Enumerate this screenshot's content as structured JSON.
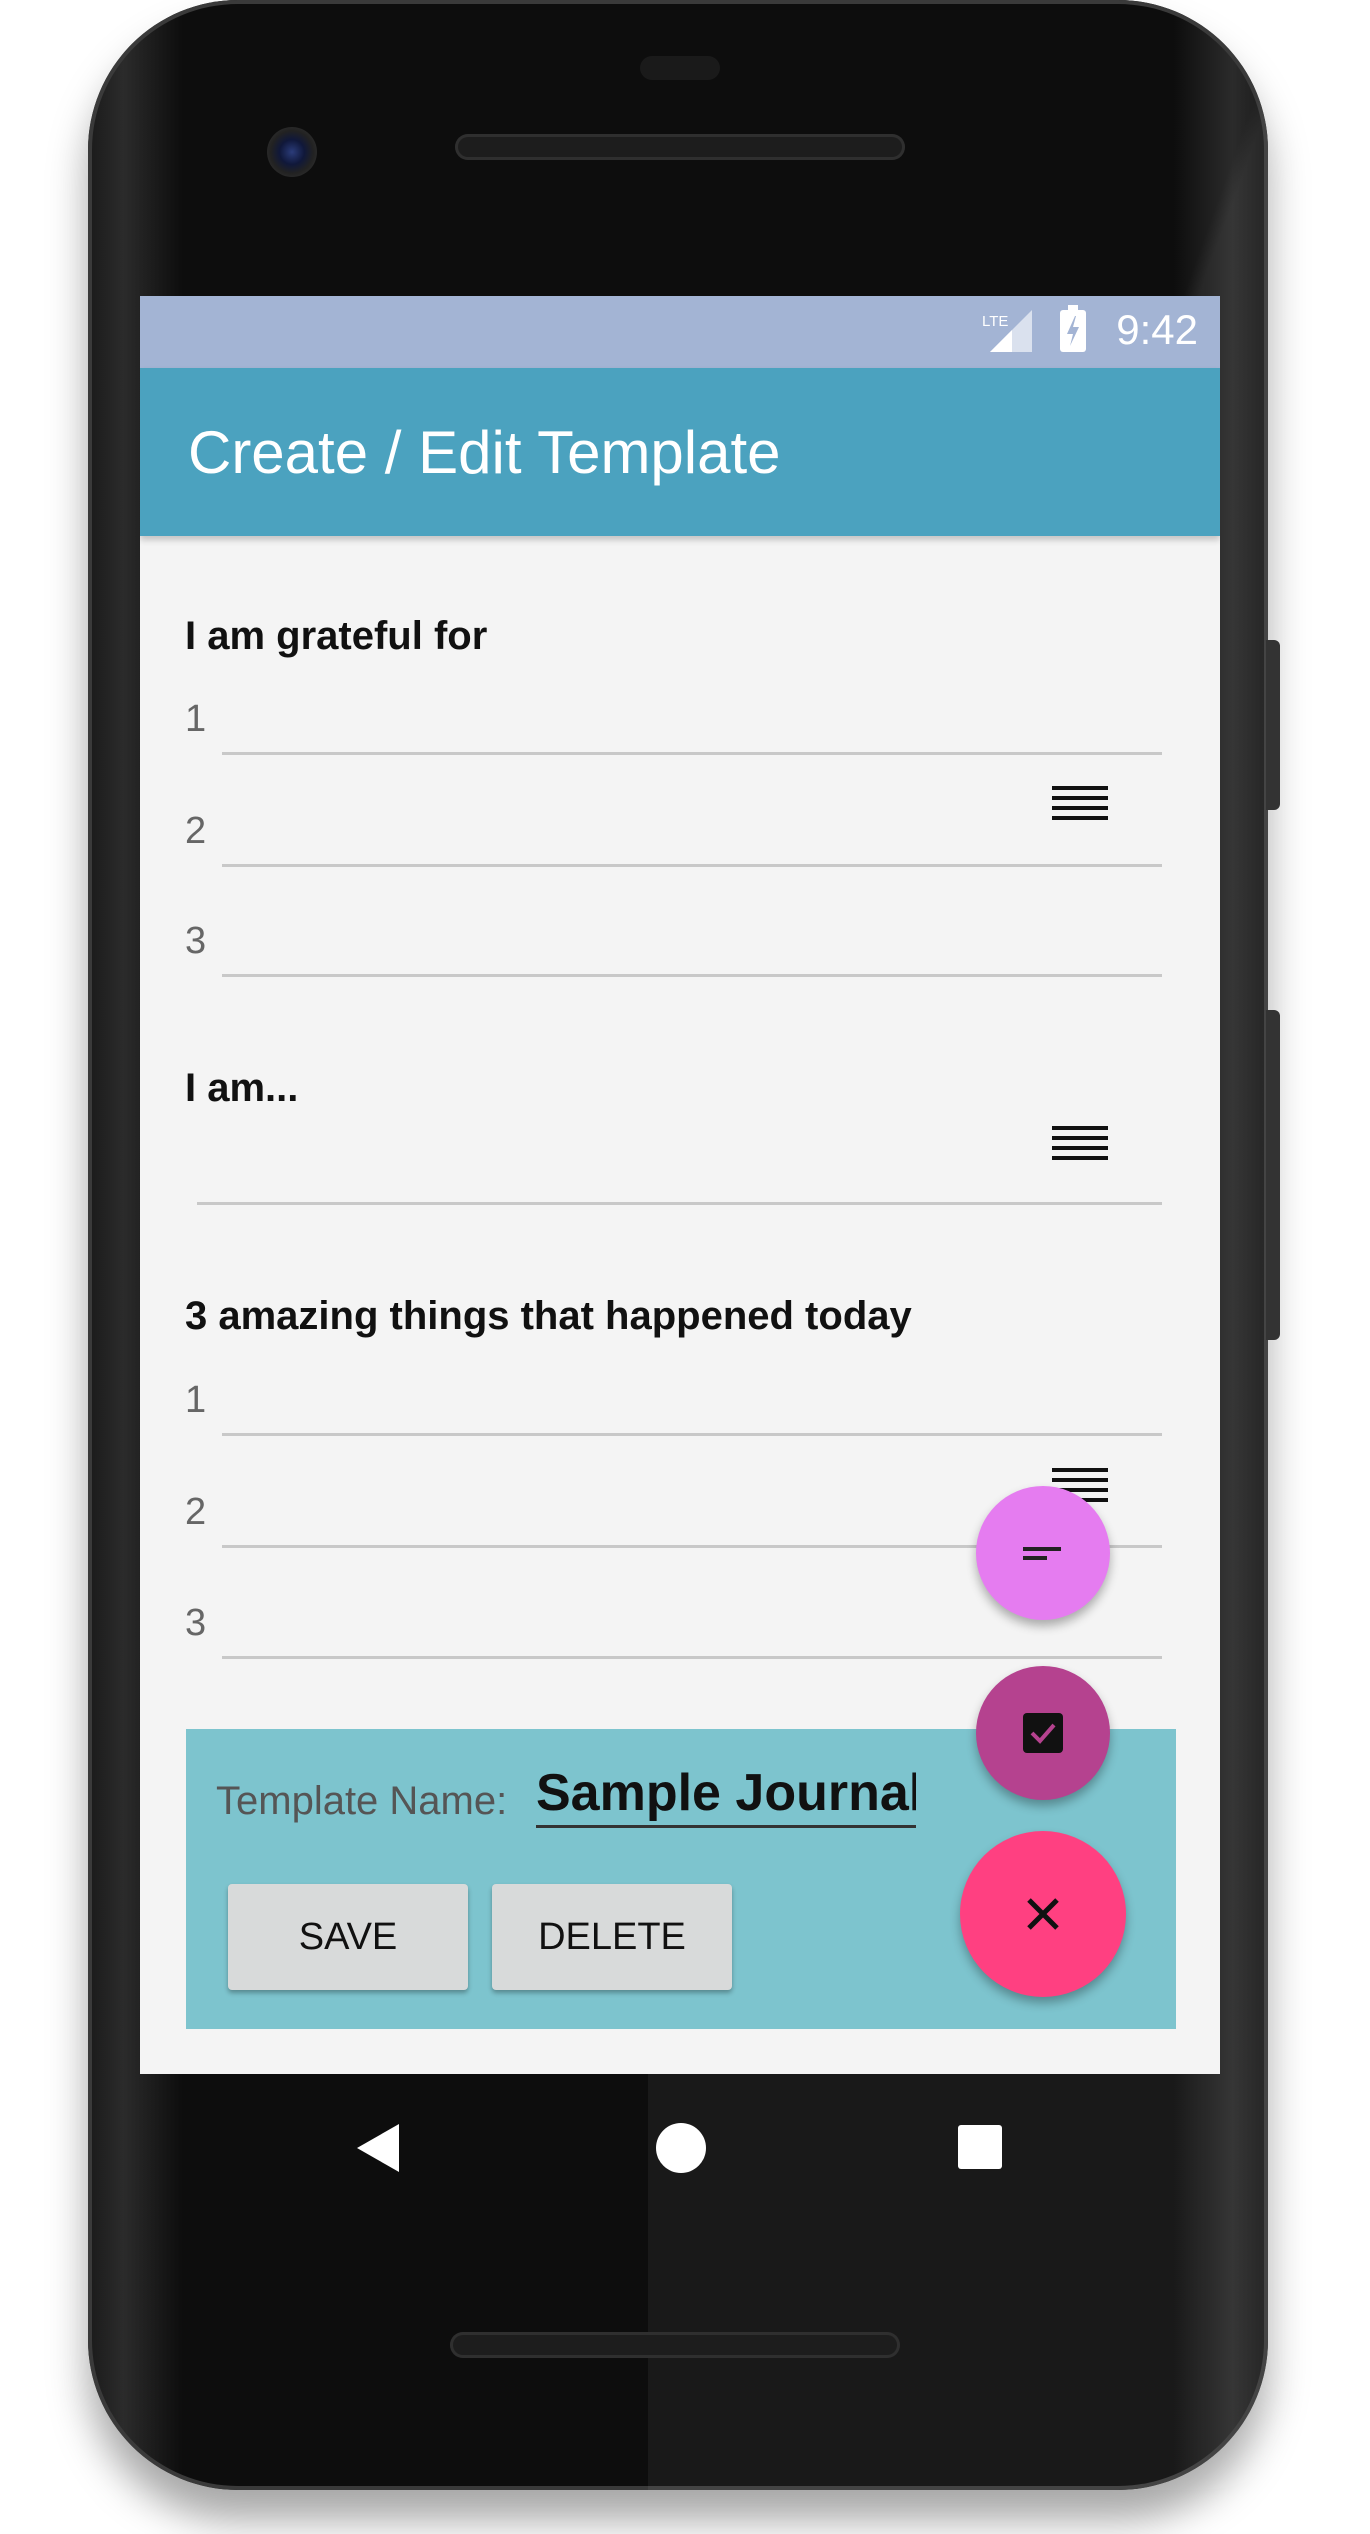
{
  "status_bar": {
    "time": "9:42",
    "network": "LTE"
  },
  "app_bar": {
    "title": "Create / Edit Template"
  },
  "sections": [
    {
      "title": "I am grateful for",
      "rows": [
        "1",
        "2",
        "3"
      ]
    },
    {
      "title": "I am...",
      "rows": []
    },
    {
      "title": "3 amazing things that happened today",
      "rows": [
        "1",
        "2",
        "3"
      ]
    }
  ],
  "template_form": {
    "label": "Template Name:",
    "name_value": "Sample Journal",
    "save_label": "SAVE",
    "delete_label": "DELETE"
  },
  "fabs": {
    "text_field_icon": "short-text-icon",
    "checkbox_icon": "checkbox-icon",
    "close_icon": "close-icon",
    "colors": {
      "text_field": "#e57cf0",
      "checkbox": "#b5428f",
      "close": "#ff4081"
    }
  },
  "colors": {
    "app_bar": "#4ba2bf",
    "status_bar": "#a3b4d4",
    "panel": "#7dc4ce"
  }
}
